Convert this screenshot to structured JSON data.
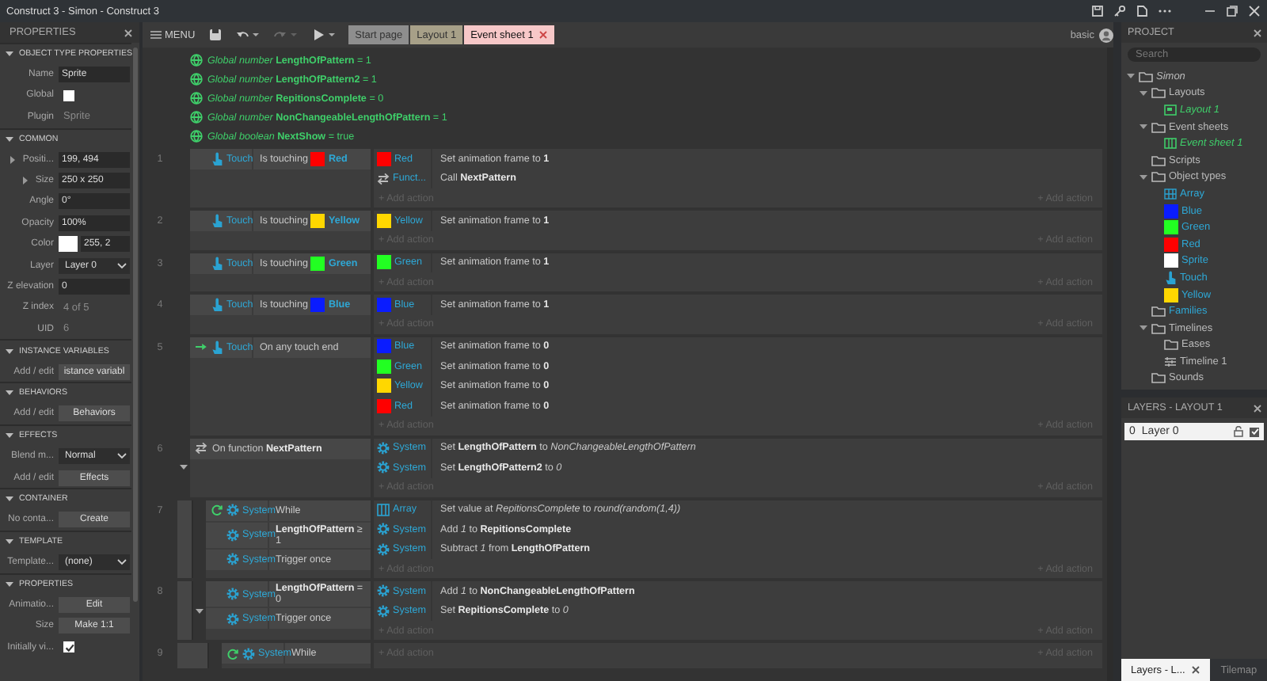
{
  "window": {
    "title": "Construct 3 - Simon - Construct 3"
  },
  "properties": {
    "title": "PROPERTIES",
    "sections": [
      {
        "title": "OBJECT TYPE PROPERTIES",
        "expanded": true,
        "rows": [
          {
            "label": "Name",
            "kind": "input",
            "value": "Sprite",
            "expandable": false
          },
          {
            "label": "Global",
            "kind": "checkbox",
            "checked": false,
            "expandable": false
          },
          {
            "label": "Plugin",
            "kind": "text",
            "value": "Sprite",
            "expandable": false
          }
        ]
      },
      {
        "title": "COMMON",
        "expanded": true,
        "rows": [
          {
            "label": "Positi...",
            "kind": "input",
            "value": "199, 494",
            "expandable": true
          },
          {
            "label": "Size",
            "kind": "input",
            "value": "250 x 250",
            "expandable": true
          },
          {
            "label": "Angle",
            "kind": "input",
            "value": "0°",
            "expandable": false
          },
          {
            "label": "Opacity",
            "kind": "input",
            "value": "100%",
            "expandable": false
          },
          {
            "label": "Color",
            "kind": "color",
            "color": "#ffffff",
            "value": "255, 2",
            "expandable": false
          },
          {
            "label": "Layer",
            "kind": "select",
            "value": "Layer 0",
            "expandable": false
          },
          {
            "label": "Z elevation",
            "kind": "input",
            "value": "0",
            "expandable": false
          },
          {
            "label": "Z index",
            "kind": "text",
            "value": "4 of 5",
            "expandable": false
          },
          {
            "label": "UID",
            "kind": "text",
            "value": "6",
            "expandable": false
          }
        ]
      },
      {
        "title": "INSTANCE VARIABLES",
        "expanded": true,
        "rows": [
          {
            "label": "Add / edit",
            "kind": "button",
            "value": "istance variabl",
            "expandable": false
          }
        ]
      },
      {
        "title": "BEHAVIORS",
        "expanded": true,
        "rows": [
          {
            "label": "Add / edit",
            "kind": "button",
            "value": "Behaviors",
            "expandable": false
          }
        ]
      },
      {
        "title": "EFFECTS",
        "expanded": true,
        "rows": [
          {
            "label": "Blend m...",
            "kind": "select",
            "value": "Normal",
            "expandable": false
          },
          {
            "label": "Add / edit",
            "kind": "button",
            "value": "Effects",
            "expandable": false
          }
        ]
      },
      {
        "title": "CONTAINER",
        "expanded": true,
        "rows": [
          {
            "label": "No conta...",
            "kind": "button",
            "value": "Create",
            "expandable": false
          }
        ]
      },
      {
        "title": "TEMPLATE",
        "expanded": true,
        "rows": [
          {
            "label": "Template...",
            "kind": "select",
            "value": "(none)",
            "expandable": false
          }
        ]
      },
      {
        "title": "PROPERTIES",
        "expanded": true,
        "rows": [
          {
            "label": "Animatio...",
            "kind": "button",
            "value": "Edit",
            "expandable": false
          },
          {
            "label": "Size",
            "kind": "button",
            "value": "Make 1:1",
            "expandable": false
          },
          {
            "label": "Initially vi...",
            "kind": "checkbox",
            "checked": true,
            "expandable": false
          }
        ]
      }
    ]
  },
  "toolbar": {
    "menu": "MENU",
    "buttons": [
      {
        "kind": "save",
        "disabled": false
      },
      {
        "kind": "undo",
        "disabled": false
      },
      {
        "kind": "redo",
        "disabled": true
      },
      {
        "kind": "play",
        "disabled": false
      }
    ],
    "tabs": [
      {
        "label": "Start page",
        "selected": false,
        "color": "#8e8e8e"
      },
      {
        "label": "Layout 1",
        "selected": false,
        "color": "#a7a088"
      },
      {
        "label": "Event sheet 1",
        "selected": true,
        "color": "#f7c8c8"
      }
    ],
    "mode": "basic"
  },
  "globals": [
    {
      "text": "*Global number* **LengthOfPattern** = 1"
    },
    {
      "text": "*Global number* **LengthOfPattern2** = 1"
    },
    {
      "text": "*Global number* **RepitionsComplete** = 0"
    },
    {
      "text": "*Global number* **NonChangeableLengthOfPattern** = 1"
    },
    {
      "text": "*Global boolean* **NextShow** = true"
    }
  ],
  "events": [
    {
      "number": "1",
      "conditions": [
        {
          "kind": "touch",
          "object": "Touch",
          "text": "Is touching",
          "param": {
            "name": "Red",
            "color": "#ff0000"
          }
        }
      ],
      "actions": [
        {
          "kind": "swatch",
          "object": "Red",
          "color": "#ff0000",
          "text": "Set animation frame to **1**"
        },
        {
          "kind": "function",
          "object": "Funct...",
          "text": "Call **NextPattern**"
        }
      ],
      "add_action": [
        "+ Add action",
        "+ Add action"
      ]
    },
    {
      "number": "2",
      "conditions": [
        {
          "kind": "touch",
          "object": "Touch",
          "text": "Is touching",
          "param": {
            "name": "Yellow",
            "color": "#ffd700"
          }
        }
      ],
      "actions": [
        {
          "kind": "swatch",
          "object": "Yellow",
          "color": "#ffd700",
          "text": "Set animation frame to **1**"
        }
      ],
      "add_action": [
        "+ Add action",
        "+ Add action"
      ]
    },
    {
      "number": "3",
      "conditions": [
        {
          "kind": "touch",
          "object": "Touch",
          "text": "Is touching",
          "param": {
            "name": "Green",
            "color": "#22ff22"
          }
        }
      ],
      "actions": [
        {
          "kind": "swatch",
          "object": "Green",
          "color": "#22ff22",
          "text": "Set animation frame to **1**"
        }
      ],
      "add_action": [
        "+ Add action",
        "+ Add action"
      ]
    },
    {
      "number": "4",
      "conditions": [
        {
          "kind": "touch",
          "object": "Touch",
          "text": "Is touching",
          "param": {
            "name": "Blue",
            "color": "#0a1cff"
          }
        }
      ],
      "actions": [
        {
          "kind": "swatch",
          "object": "Blue",
          "color": "#0a1cff",
          "text": "Set animation frame to **1**"
        }
      ],
      "add_action": [
        "+ Add action",
        "+ Add action"
      ]
    },
    {
      "number": "5",
      "conditions": [
        {
          "kind": "touch_trigger",
          "object": "Touch",
          "text": "On any touch end"
        }
      ],
      "actions": [
        {
          "kind": "swatch",
          "object": "Blue",
          "color": "#0a1cff",
          "text": "Set animation frame to **0**"
        },
        {
          "kind": "swatch",
          "object": "Green",
          "color": "#22ff22",
          "text": "Set animation frame to **0**"
        },
        {
          "kind": "swatch",
          "object": "Yellow",
          "color": "#ffd700",
          "text": "Set animation frame to **0**"
        },
        {
          "kind": "swatch",
          "object": "Red",
          "color": "#ff0000",
          "text": "Set animation frame to **0**"
        }
      ],
      "add_action": [
        "+ Add action",
        "+ Add action"
      ]
    },
    {
      "number": "6",
      "expanded": true,
      "conditions": [
        {
          "kind": "function",
          "text": "On function **NextPattern**"
        }
      ],
      "actions": [
        {
          "kind": "system",
          "object": "System",
          "text": "Set **LengthOfPattern** to *NonChangeableLengthOfPattern*"
        },
        {
          "kind": "system",
          "object": "System",
          "text": "Set **LengthOfPattern2** to *0*"
        }
      ],
      "add_action": [
        "+ Add action",
        "+ Add action"
      ],
      "children": [
        {
          "number": "7",
          "conditions": [
            {
              "kind": "system_loop",
              "object": "System",
              "text": "While"
            },
            {
              "kind": "system",
              "object": "System",
              "text": "**LengthOfPattern** ≥ 1"
            },
            {
              "kind": "system",
              "object": "System",
              "text": "Trigger once"
            }
          ],
          "actions": [
            {
              "kind": "array",
              "object": "Array",
              "text": "Set value at *RepitionsComplete* to *round(random(1,4))*"
            },
            {
              "kind": "system",
              "object": "System",
              "text": "Add *1* to **RepitionsComplete**"
            },
            {
              "kind": "system",
              "object": "System",
              "text": "Subtract *1* from **LengthOfPattern**"
            }
          ],
          "add_action": [
            "+ Add action",
            "+ Add action"
          ]
        },
        {
          "number": "8",
          "expanded": true,
          "conditions": [
            {
              "kind": "system",
              "object": "System",
              "text": "**LengthOfPattern** = 0"
            },
            {
              "kind": "system",
              "object": "System",
              "text": "Trigger once"
            }
          ],
          "actions": [
            {
              "kind": "system",
              "object": "System",
              "text": "Add *1* to **NonChangeableLengthOfPattern**"
            },
            {
              "kind": "system",
              "object": "System",
              "text": "Set **RepitionsComplete** to *0*"
            }
          ],
          "add_action": [
            "+ Add action",
            "+ Add action"
          ],
          "children": [
            {
              "number": "9",
              "conditions": [
                {
                  "kind": "system_loop",
                  "object": "System",
                  "text": "While"
                }
              ],
              "add_action": [
                "+ Add action",
                "+ Add action"
              ]
            }
          ]
        }
      ]
    }
  ],
  "project": {
    "title": "PROJECT",
    "search": {
      "placeholder": "Search"
    },
    "tree": [
      {
        "label": "Simon",
        "kind": "project",
        "expanded": true,
        "children": [
          {
            "label": "Layouts",
            "kind": "folder",
            "expanded": true,
            "children": [
              {
                "label": "Layout 1",
                "kind": "layout"
              }
            ]
          },
          {
            "label": "Event sheets",
            "kind": "folder",
            "expanded": true,
            "children": [
              {
                "label": "Event sheet 1",
                "kind": "eventsheet"
              }
            ]
          },
          {
            "label": "Scripts",
            "kind": "folder"
          },
          {
            "label": "Object types",
            "kind": "folder",
            "expanded": true,
            "children": [
              {
                "label": "Array",
                "kind": "array"
              },
              {
                "label": "Blue",
                "kind": "swatch",
                "color": "#0a1cff"
              },
              {
                "label": "Green",
                "kind": "swatch",
                "color": "#22ff22"
              },
              {
                "label": "Red",
                "kind": "swatch",
                "color": "#ff0000"
              },
              {
                "label": "Sprite",
                "kind": "swatch",
                "color": "#ffffff"
              },
              {
                "label": "Touch",
                "kind": "touch"
              },
              {
                "label": "Yellow",
                "kind": "swatch",
                "color": "#ffd700"
              }
            ]
          },
          {
            "label": "Families",
            "kind": "families"
          },
          {
            "label": "Timelines",
            "kind": "folder",
            "expanded": true,
            "children": [
              {
                "label": "Eases",
                "kind": "folder"
              },
              {
                "label": "Timeline 1",
                "kind": "timeline"
              }
            ]
          },
          {
            "label": "Sounds",
            "kind": "folder"
          }
        ]
      }
    ]
  },
  "layers": {
    "title": "LAYERS - LAYOUT 1",
    "items": [
      {
        "index": "0",
        "name": "Layer 0",
        "selected": true,
        "locked": false,
        "visible": true
      }
    ]
  },
  "bottom_tabs": [
    {
      "label": "Layers - L...",
      "selected": true
    },
    {
      "label": "Tilemap",
      "selected": false
    }
  ]
}
